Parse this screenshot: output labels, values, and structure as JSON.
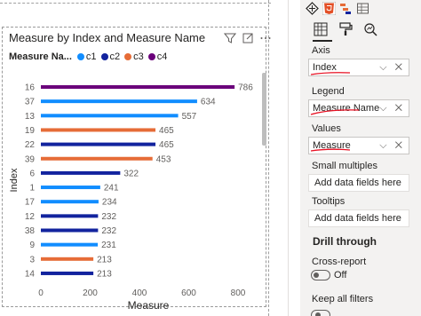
{
  "visual": {
    "title": "Measure by Index and Measure Name",
    "legend_title": "Measure Na...",
    "legend": [
      {
        "name": "c1",
        "color": "#118dff"
      },
      {
        "name": "c2",
        "color": "#12239e"
      },
      {
        "name": "c3",
        "color": "#e66c37"
      },
      {
        "name": "c4",
        "color": "#6b007b"
      }
    ],
    "header_icons": [
      "filter-icon",
      "focus-mode-icon",
      "more-options-icon"
    ]
  },
  "chart_data": {
    "type": "bar",
    "orientation": "horizontal",
    "title": "Measure by Index and Measure Name",
    "xlabel": "Measure",
    "ylabel": "Index",
    "xlim": [
      0,
      800
    ],
    "xticks": [
      "0",
      "200",
      "400",
      "600",
      "800"
    ],
    "grid": false,
    "categories": [
      "16",
      "37",
      "13",
      "19",
      "22",
      "39",
      "6",
      "1",
      "17",
      "12",
      "38",
      "9",
      "3",
      "14"
    ],
    "values": [
      786,
      634,
      557,
      465,
      465,
      453,
      322,
      241,
      234,
      232,
      232,
      231,
      213,
      213
    ],
    "series_of_bar": [
      "c4",
      "c1",
      "c1",
      "c3",
      "c2",
      "c3",
      "c2",
      "c1",
      "c1",
      "c2",
      "c2",
      "c1",
      "c3",
      "c2"
    ],
    "series": [
      {
        "name": "c1",
        "color": "#118dff"
      },
      {
        "name": "c2",
        "color": "#12239e"
      },
      {
        "name": "c3",
        "color": "#e66c37"
      },
      {
        "name": "c4",
        "color": "#6b007b"
      }
    ]
  },
  "panel": {
    "top_icons": [
      "visual-types-icon",
      "html5-icon",
      "hierarchy-icon",
      "table-icon"
    ],
    "sub_icons": [
      "fields-icon",
      "format-paintbrush-icon",
      "analytics-icon"
    ],
    "axis_label": "Axis",
    "axis_value": "Index",
    "legend_label": "Legend",
    "legend_value": "Measure Name",
    "values_label": "Values",
    "values_value": "Measure",
    "small_multiples_label": "Small multiples",
    "small_multiples_placeholder": "Add data fields here",
    "tooltips_label": "Tooltips",
    "tooltips_placeholder": "Add data fields here",
    "drill_title": "Drill through",
    "cross_report_label": "Cross-report",
    "cross_report_state": "Off",
    "keep_filters_label": "Keep all filters",
    "well_controls": "⌵ ✕",
    "annotation_color": "#e81123"
  }
}
